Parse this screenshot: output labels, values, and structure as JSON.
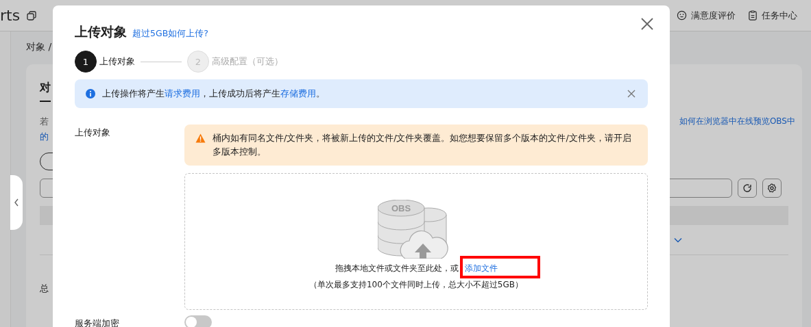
{
  "top_bar": {
    "brand_fragment": "rts",
    "links": [
      {
        "label": "满意度评价",
        "kind": "smile"
      },
      {
        "label": "任务中心",
        "kind": "clipboard"
      }
    ]
  },
  "breadcrumb": "对象 /",
  "page": {
    "tab": {
      "label": "对",
      "selected": true
    },
    "hint": "若",
    "hint_link": "的",
    "right_link": "如何在浏览器中在线预览OBS中",
    "total": "总"
  },
  "dialog": {
    "title": "上传对象",
    "help_link": "超过5GB如何上传?",
    "steps": [
      {
        "number": "1",
        "label": "上传对象",
        "selected": true
      },
      {
        "number": "2",
        "label": "高级配置（可选）",
        "selected": false
      }
    ],
    "info": [
      {
        "kind": "text",
        "text": "上传操作将产生"
      },
      {
        "kind": "link",
        "text": "请求费用"
      },
      {
        "kind": "text",
        "text": "，上传成功后将产生"
      },
      {
        "kind": "link",
        "text": "存储费用"
      },
      {
        "kind": "text",
        "text": "。"
      }
    ],
    "warning": "桶内如有同名文件/文件夹，将被新上传的文件/文件夹覆盖。如您想要保留多个版本的文件/文件夹，请开启多版本控制。",
    "upload": {
      "label": "上传对象",
      "illustration_text": "OBS",
      "prompt": "拖拽本地文件或文件夹至此处，或",
      "add_link": "添加文件",
      "limit": "（单次最多支持100个文件同时上传，总大小不超过5GB）"
    },
    "encryption": {
      "label": "服务端加密",
      "on": false
    }
  },
  "highlight": {
    "kind": "rectangle"
  }
}
